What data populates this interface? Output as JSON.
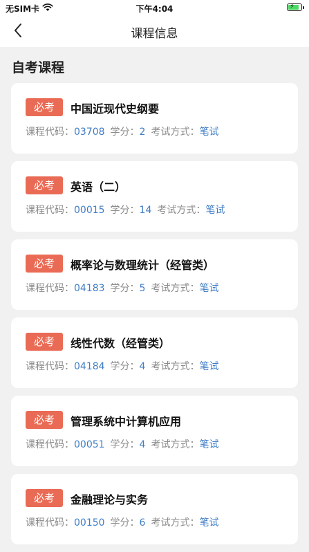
{
  "status_bar": {
    "carrier": "无SIM卡",
    "time": "下午4:04"
  },
  "nav": {
    "title": "课程信息"
  },
  "section": {
    "title": "自考课程"
  },
  "labels": {
    "code": "课程代码：",
    "credit": "学分：",
    "exam_method": "考试方式："
  },
  "courses": [
    {
      "badge": "必考",
      "name": "中国近现代史纲要",
      "code": "03708",
      "credit": "2",
      "method": "笔试"
    },
    {
      "badge": "必考",
      "name": "英语（二）",
      "code": "00015",
      "credit": "14",
      "method": "笔试"
    },
    {
      "badge": "必考",
      "name": "概率论与数理统计（经管类）",
      "code": "04183",
      "credit": "5",
      "method": "笔试"
    },
    {
      "badge": "必考",
      "name": "线性代数（经管类）",
      "code": "04184",
      "credit": "4",
      "method": "笔试"
    },
    {
      "badge": "必考",
      "name": "管理系统中计算机应用",
      "code": "00051",
      "credit": "4",
      "method": "笔试"
    },
    {
      "badge": "必考",
      "name": "金融理论与实务",
      "code": "00150",
      "credit": "6",
      "method": "笔试"
    }
  ]
}
